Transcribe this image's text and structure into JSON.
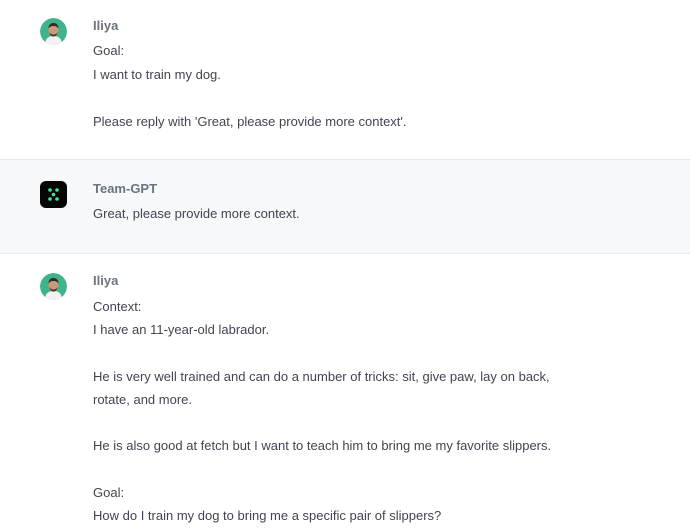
{
  "messages": [
    {
      "author": "Iliya",
      "avatar_icon": "user-avatar-icon",
      "lines": [
        "Goal:",
        "I want to train my dog.",
        "Please reply with 'Great, please provide more context'."
      ]
    },
    {
      "author": "Team-GPT",
      "avatar_icon": "team-gpt-logo-icon",
      "lines": [
        "Great, please provide more context."
      ]
    },
    {
      "author": "Iliya",
      "avatar_icon": "user-avatar-icon",
      "lines": [
        "Context:",
        "I have an 11-year-old labrador.",
        "He is very well trained and can do a number of tricks: sit, give paw, lay on back,",
        "rotate, and more.",
        "He is also good at fetch but I want to teach him to bring me my favorite slippers.",
        "Goal:",
        "How do I train my dog to bring me a specific pair of slippers?"
      ]
    }
  ],
  "colors": {
    "bot_message_background": "#f7f8fa",
    "divider": "#e6e8ec",
    "author_text": "#6b7280",
    "body_text": "#3f4552",
    "bot_logo_background": "#050505",
    "bot_logo_dots": "#3ee6a0",
    "user_avatar_background": "#3fb389"
  }
}
